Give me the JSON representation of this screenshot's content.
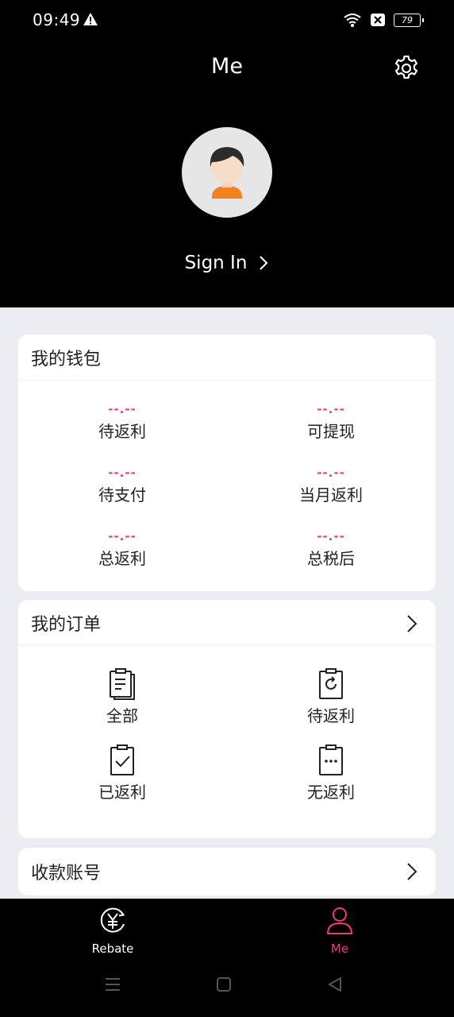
{
  "status_bar": {
    "time": "09:49",
    "battery": "79"
  },
  "header": {
    "title": "Me",
    "sign_in_label": "Sign In"
  },
  "wallet": {
    "title": "我的钱包",
    "items": [
      {
        "value": "--.--",
        "label": "待返利"
      },
      {
        "value": "--.--",
        "label": "可提现"
      },
      {
        "value": "--.--",
        "label": "待支付"
      },
      {
        "value": "--.--",
        "label": "当月返利"
      },
      {
        "value": "--.--",
        "label": "总返利"
      },
      {
        "value": "--.--",
        "label": "总税后"
      }
    ]
  },
  "orders": {
    "title": "我的订单",
    "items": [
      {
        "label": "全部",
        "icon": "clipboard-list-icon"
      },
      {
        "label": "待返利",
        "icon": "clipboard-refresh-icon"
      },
      {
        "label": "已返利",
        "icon": "clipboard-check-icon"
      },
      {
        "label": "无返利",
        "icon": "clipboard-dots-icon"
      }
    ]
  },
  "account": {
    "title": "收款账号"
  },
  "bottom_nav": {
    "tabs": [
      {
        "label": "Rebate",
        "icon": "yen-rebate-icon",
        "active": false
      },
      {
        "label": "Me",
        "icon": "person-icon",
        "active": true
      }
    ]
  },
  "colors": {
    "accent": "#ee3a7a",
    "header_bg": "#000000",
    "page_bg": "#ecedf2"
  }
}
